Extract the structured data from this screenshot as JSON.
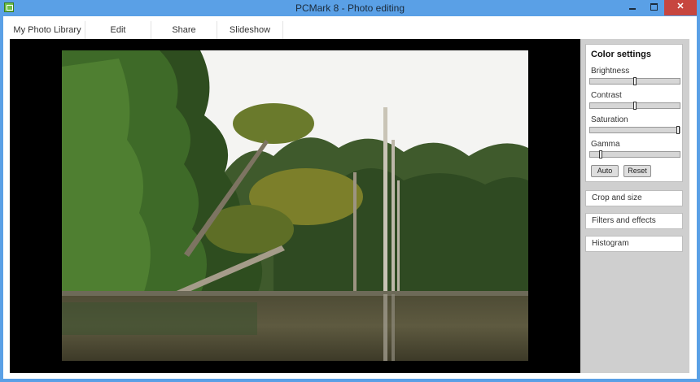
{
  "window": {
    "title": "PCMark 8 - Photo editing",
    "close_glyph": "✕"
  },
  "tabs": [
    {
      "label": "My Photo Library"
    },
    {
      "label": "Edit"
    },
    {
      "label": "Share"
    },
    {
      "label": "Slideshow"
    }
  ],
  "panel": {
    "title": "Color settings",
    "sliders": [
      {
        "label": "Brightness",
        "value": 0.5
      },
      {
        "label": "Contrast",
        "value": 0.5
      },
      {
        "label": "Saturation",
        "value": 1.0
      },
      {
        "label": "Gamma",
        "value": 0.1
      }
    ],
    "auto_label": "Auto",
    "reset_label": "Reset",
    "sections": [
      {
        "label": "Crop and size"
      },
      {
        "label": "Filters and effects"
      },
      {
        "label": "Histogram"
      }
    ]
  },
  "colors": {
    "titlebar": "#5aa0e6",
    "close": "#c7463f",
    "panel": "#cfcfcf"
  },
  "icons": [
    "app-icon",
    "minimize-icon",
    "maximize-icon",
    "close-icon"
  ]
}
